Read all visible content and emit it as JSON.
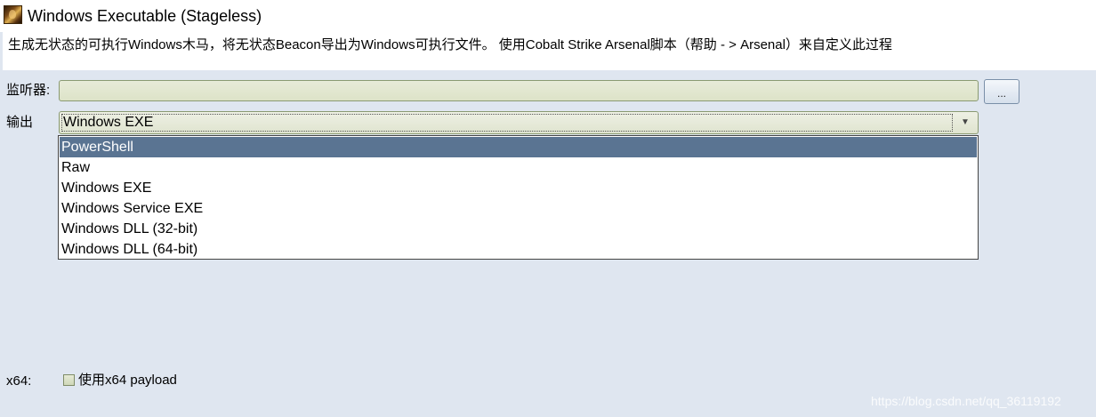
{
  "window": {
    "title": "Windows Executable (Stageless)",
    "icon": "app-icon"
  },
  "description": "生成无状态的可执行Windows木马，将无状态Beacon导出为Windows可执行文件。 使用Cobalt Strike Arsenal脚本（帮助 - > Arsenal）来自定义此过程",
  "form": {
    "listener_label": "监听器:",
    "listener_value": "",
    "browse_label": "...",
    "output_label": "输出",
    "output_selected": "Windows EXE",
    "output_options": [
      "PowerShell",
      "Raw",
      "Windows EXE",
      "Windows Service EXE",
      "Windows DLL (32-bit)",
      "Windows DLL (64-bit)"
    ],
    "highlighted_option": "PowerShell",
    "x64_label": "x64:",
    "x64_checkbox_label": "使用x64 payload",
    "x64_checked": false
  },
  "watermark": "https://blog.csdn.net/qq_36119192",
  "colors": {
    "background": "#dfe6f0",
    "highlight": "#5a7492",
    "field": "#e1e6cf"
  }
}
